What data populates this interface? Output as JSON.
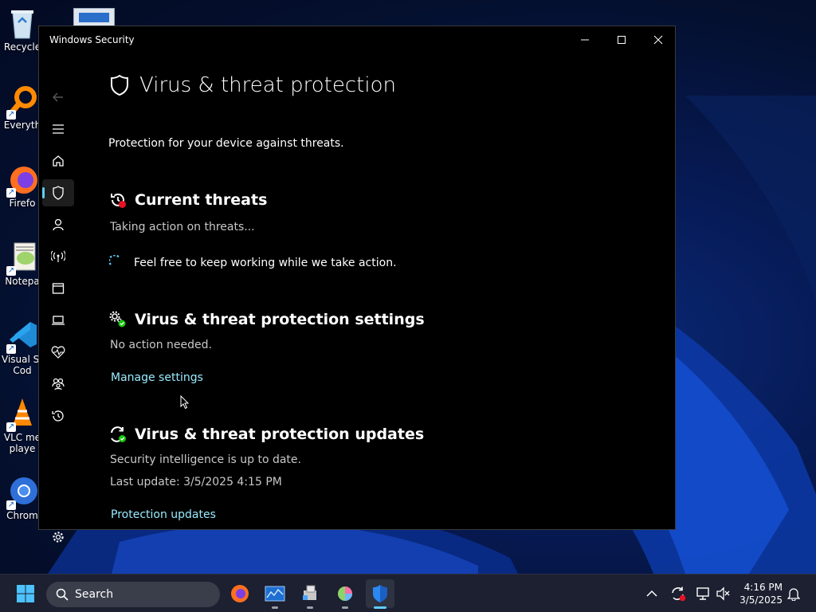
{
  "desktop": {
    "icons": [
      {
        "label": "Recycle",
        "icon": "recycle-bin-icon"
      },
      {
        "label": "Everyth",
        "icon": "everything-search-icon"
      },
      {
        "label": "Firefo",
        "icon": "firefox-icon"
      },
      {
        "label": "Notepa",
        "icon": "notepad-plus-plus-icon"
      },
      {
        "label": "Visual St",
        "label2": "Cod",
        "icon": "vscode-icon"
      },
      {
        "label": "VLC me",
        "label2": "playe",
        "icon": "vlc-icon"
      },
      {
        "label": "Chrom",
        "icon": "chrome-icon"
      }
    ]
  },
  "window": {
    "title": "Windows Security",
    "controls": [
      "minimize",
      "maximize",
      "close"
    ]
  },
  "nav": {
    "items": [
      {
        "icon": "back-arrow-icon"
      },
      {
        "icon": "hamburger-menu-icon"
      },
      {
        "icon": "home-icon"
      },
      {
        "icon": "shield-icon",
        "active": true
      },
      {
        "icon": "account-person-icon"
      },
      {
        "icon": "firewall-antenna-icon"
      },
      {
        "icon": "app-browser-window-icon"
      },
      {
        "icon": "device-laptop-icon"
      },
      {
        "icon": "health-heartbeat-icon"
      },
      {
        "icon": "family-icon"
      },
      {
        "icon": "history-icon"
      },
      {
        "icon": "settings-gear-icon"
      }
    ]
  },
  "page": {
    "title": "Virus & threat protection",
    "subtitle": "Protection for your device against threats.",
    "current_threats": {
      "title": "Current threats",
      "status": "Taking action on threats...",
      "progress_text": "Feel free to keep working while we take action."
    },
    "settings": {
      "title": "Virus & threat protection settings",
      "status": "No action needed.",
      "link": "Manage settings"
    },
    "updates": {
      "title": "Virus & threat protection updates",
      "status": "Security intelligence is up to date.",
      "last_update": "Last update: 3/5/2025 4:15 PM",
      "link": "Protection updates"
    }
  },
  "taskbar": {
    "search_label": "Search",
    "apps": [
      "firefox-icon",
      "task-manager-icon",
      "installer-icon",
      "color-picker-icon",
      "windows-security-shield-icon"
    ],
    "time": "4:16 PM",
    "date": "3/5/2025"
  },
  "colors": {
    "accent": "#60cdff",
    "link": "#99ebff",
    "window_bg": "#000000",
    "taskbar_bg": "#1c2030"
  }
}
